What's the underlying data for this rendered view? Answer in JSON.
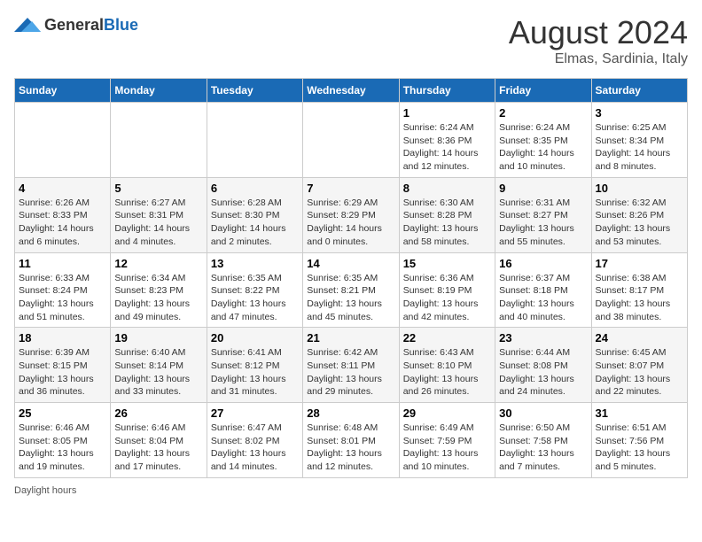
{
  "header": {
    "logo_general": "General",
    "logo_blue": "Blue",
    "month_year": "August 2024",
    "location": "Elmas, Sardinia, Italy"
  },
  "days_of_week": [
    "Sunday",
    "Monday",
    "Tuesday",
    "Wednesday",
    "Thursday",
    "Friday",
    "Saturday"
  ],
  "weeks": [
    [
      {
        "day": "",
        "info": ""
      },
      {
        "day": "",
        "info": ""
      },
      {
        "day": "",
        "info": ""
      },
      {
        "day": "",
        "info": ""
      },
      {
        "day": "1",
        "info": "Sunrise: 6:24 AM\nSunset: 8:36 PM\nDaylight: 14 hours\nand 12 minutes."
      },
      {
        "day": "2",
        "info": "Sunrise: 6:24 AM\nSunset: 8:35 PM\nDaylight: 14 hours\nand 10 minutes."
      },
      {
        "day": "3",
        "info": "Sunrise: 6:25 AM\nSunset: 8:34 PM\nDaylight: 14 hours\nand 8 minutes."
      }
    ],
    [
      {
        "day": "4",
        "info": "Sunrise: 6:26 AM\nSunset: 8:33 PM\nDaylight: 14 hours\nand 6 minutes."
      },
      {
        "day": "5",
        "info": "Sunrise: 6:27 AM\nSunset: 8:31 PM\nDaylight: 14 hours\nand 4 minutes."
      },
      {
        "day": "6",
        "info": "Sunrise: 6:28 AM\nSunset: 8:30 PM\nDaylight: 14 hours\nand 2 minutes."
      },
      {
        "day": "7",
        "info": "Sunrise: 6:29 AM\nSunset: 8:29 PM\nDaylight: 14 hours\nand 0 minutes."
      },
      {
        "day": "8",
        "info": "Sunrise: 6:30 AM\nSunset: 8:28 PM\nDaylight: 13 hours\nand 58 minutes."
      },
      {
        "day": "9",
        "info": "Sunrise: 6:31 AM\nSunset: 8:27 PM\nDaylight: 13 hours\nand 55 minutes."
      },
      {
        "day": "10",
        "info": "Sunrise: 6:32 AM\nSunset: 8:26 PM\nDaylight: 13 hours\nand 53 minutes."
      }
    ],
    [
      {
        "day": "11",
        "info": "Sunrise: 6:33 AM\nSunset: 8:24 PM\nDaylight: 13 hours\nand 51 minutes."
      },
      {
        "day": "12",
        "info": "Sunrise: 6:34 AM\nSunset: 8:23 PM\nDaylight: 13 hours\nand 49 minutes."
      },
      {
        "day": "13",
        "info": "Sunrise: 6:35 AM\nSunset: 8:22 PM\nDaylight: 13 hours\nand 47 minutes."
      },
      {
        "day": "14",
        "info": "Sunrise: 6:35 AM\nSunset: 8:21 PM\nDaylight: 13 hours\nand 45 minutes."
      },
      {
        "day": "15",
        "info": "Sunrise: 6:36 AM\nSunset: 8:19 PM\nDaylight: 13 hours\nand 42 minutes."
      },
      {
        "day": "16",
        "info": "Sunrise: 6:37 AM\nSunset: 8:18 PM\nDaylight: 13 hours\nand 40 minutes."
      },
      {
        "day": "17",
        "info": "Sunrise: 6:38 AM\nSunset: 8:17 PM\nDaylight: 13 hours\nand 38 minutes."
      }
    ],
    [
      {
        "day": "18",
        "info": "Sunrise: 6:39 AM\nSunset: 8:15 PM\nDaylight: 13 hours\nand 36 minutes."
      },
      {
        "day": "19",
        "info": "Sunrise: 6:40 AM\nSunset: 8:14 PM\nDaylight: 13 hours\nand 33 minutes."
      },
      {
        "day": "20",
        "info": "Sunrise: 6:41 AM\nSunset: 8:12 PM\nDaylight: 13 hours\nand 31 minutes."
      },
      {
        "day": "21",
        "info": "Sunrise: 6:42 AM\nSunset: 8:11 PM\nDaylight: 13 hours\nand 29 minutes."
      },
      {
        "day": "22",
        "info": "Sunrise: 6:43 AM\nSunset: 8:10 PM\nDaylight: 13 hours\nand 26 minutes."
      },
      {
        "day": "23",
        "info": "Sunrise: 6:44 AM\nSunset: 8:08 PM\nDaylight: 13 hours\nand 24 minutes."
      },
      {
        "day": "24",
        "info": "Sunrise: 6:45 AM\nSunset: 8:07 PM\nDaylight: 13 hours\nand 22 minutes."
      }
    ],
    [
      {
        "day": "25",
        "info": "Sunrise: 6:46 AM\nSunset: 8:05 PM\nDaylight: 13 hours\nand 19 minutes."
      },
      {
        "day": "26",
        "info": "Sunrise: 6:46 AM\nSunset: 8:04 PM\nDaylight: 13 hours\nand 17 minutes."
      },
      {
        "day": "27",
        "info": "Sunrise: 6:47 AM\nSunset: 8:02 PM\nDaylight: 13 hours\nand 14 minutes."
      },
      {
        "day": "28",
        "info": "Sunrise: 6:48 AM\nSunset: 8:01 PM\nDaylight: 13 hours\nand 12 minutes."
      },
      {
        "day": "29",
        "info": "Sunrise: 6:49 AM\nSunset: 7:59 PM\nDaylight: 13 hours\nand 10 minutes."
      },
      {
        "day": "30",
        "info": "Sunrise: 6:50 AM\nSunset: 7:58 PM\nDaylight: 13 hours\nand 7 minutes."
      },
      {
        "day": "31",
        "info": "Sunrise: 6:51 AM\nSunset: 7:56 PM\nDaylight: 13 hours\nand 5 minutes."
      }
    ]
  ],
  "footer": {
    "daylight_label": "Daylight hours"
  }
}
